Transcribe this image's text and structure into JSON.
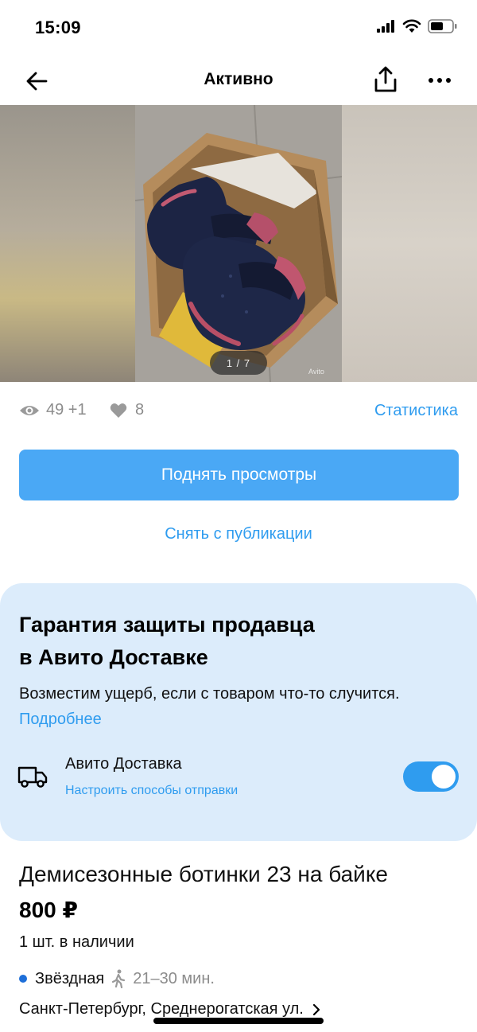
{
  "status_bar": {
    "time": "15:09"
  },
  "nav": {
    "title": "Активно"
  },
  "gallery": {
    "counter": "1 / 7",
    "watermark": "Avito"
  },
  "stats": {
    "views": "49 +1",
    "likes": "8",
    "statistics_link": "Статистика"
  },
  "actions": {
    "raise_button": "Поднять просмотры",
    "unpublish_link": "Снять с публикации"
  },
  "protection": {
    "title_line1": "Гарантия защиты продавца",
    "title_line2": "в Авито Доставке",
    "description": "Возместим ущерб, если с товаром что-то случится.",
    "more_link": "Подробнее",
    "delivery_title": "Авито Доставка",
    "delivery_subtitle": "Настроить способы отправки",
    "delivery_enabled": true
  },
  "item": {
    "title": "Демисезонные ботинки 23 на байке",
    "price": "800 ₽",
    "stock": "1 шт. в наличии",
    "metro_station": "Звёздная",
    "metro_time": "21–30 мин.",
    "address": "Санкт-Петербург, Среднерогатская ул."
  },
  "colors": {
    "accent": "#2f9cef",
    "button": "#4aa8f5",
    "card_bg": "#dcecfb",
    "metro_line": "#1e6fd9"
  }
}
